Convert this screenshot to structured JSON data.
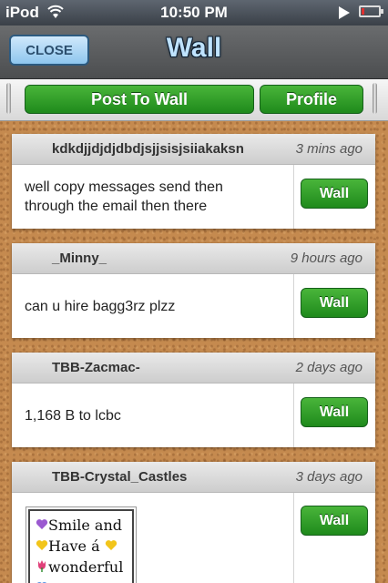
{
  "status_bar": {
    "carrier": "iPod",
    "time": "10:50 PM"
  },
  "nav": {
    "close_label": "CLOSE",
    "title": "Wall"
  },
  "actions": {
    "post_label": "Post To Wall",
    "profile_label": "Profile"
  },
  "posts": [
    {
      "author": "kdkdjjdjdjdbdjsjjsisjsiiakaksn",
      "time_ago": "3 mins ago",
      "message_line1": "well copy messages send then",
      "message_line2": "through the email then there",
      "wall_label": "Wall"
    },
    {
      "author": "_Minny_",
      "time_ago": "9 hours ago",
      "message": "can u hire bagg3rz plzz",
      "wall_label": "Wall"
    },
    {
      "author": "TBB-Zacmac-",
      "time_ago": "2 days ago",
      "message": "1,168 B to lcbc",
      "wall_label": "Wall"
    },
    {
      "author": "TBB-Crystal_Castles",
      "time_ago": "3 days ago",
      "message_line1": "Smile and",
      "message_line2": "Have á",
      "message_line3": "wonderful",
      "wall_label": "Wall"
    }
  ],
  "colors": {
    "purple_heart": "#9b59d0",
    "yellow_heart": "#f2c51a",
    "blue_heart": "#4a8be0",
    "tulip": "#e0407a"
  }
}
